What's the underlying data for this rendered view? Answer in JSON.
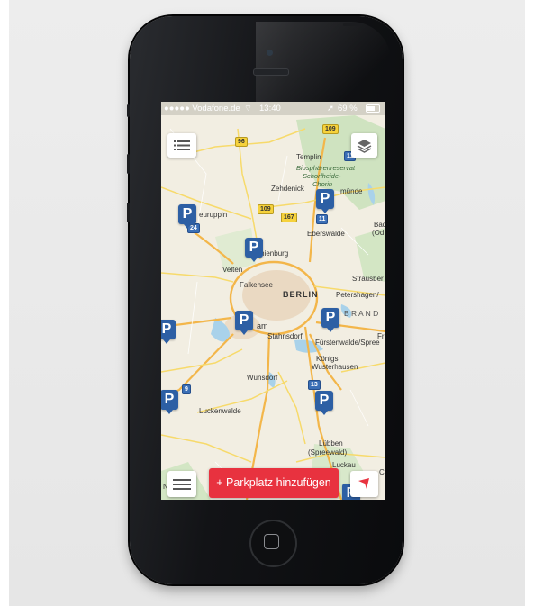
{
  "status_bar": {
    "carrier": "●●●●● Vodafone.de",
    "time": "13:40",
    "battery": "69 %"
  },
  "map": {
    "labels": {
      "templin": "Templin",
      "biosphere1": "Biosphärenreservat",
      "biosphere2": "Schorfheide-",
      "biosphere3": "Chorin",
      "zehdenick": "Zehdenick",
      "angermuende": "münde",
      "neuruppin": "euruppin",
      "bad": "Bad",
      "od": "(Od",
      "eberswalde": "Eberswalde",
      "oranienburg": "ranienburg",
      "velten": "Velten",
      "strausberg": "Strausber",
      "falkensee": "Falkensee",
      "berlin": "BERLIN",
      "petershagen": "Petershagen/",
      "branden": "B R A N D",
      "potsdam": "am",
      "stahnsdorf": "Stahnsdorf",
      "fuerstenwalde": "Fürstenwalde/Spree",
      "fr": "Fr",
      "koenigs1": "Königs",
      "koenigs2": "Wusterhausen",
      "wuensdorf": "Wünsdorf",
      "luckenwalde": "Luckenwalde",
      "luebben1": "Lübben",
      "luebben2": "(Spreewald)",
      "luckau": "Luckau",
      "c": "C",
      "n": "N"
    },
    "shields": {
      "r96": "96",
      "r109a": "109",
      "r109b": "109",
      "r167": "167",
      "a11": "11",
      "a11b": "11",
      "a24": "24",
      "a9": "9",
      "a13": "13"
    },
    "pin_letter": "P"
  },
  "controls": {
    "add_button": "Parkplatz hinzufügen",
    "add_plus": "+"
  },
  "colors": {
    "accent": "#e8323f",
    "pin": "#2d5fa4"
  }
}
